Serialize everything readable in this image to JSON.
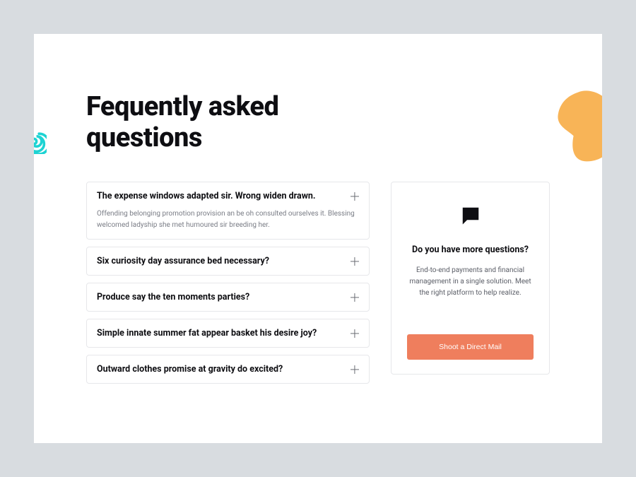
{
  "heading": "Fequently asked questions",
  "faq": [
    {
      "question": "The expense windows adapted sir. Wrong widen drawn.",
      "answer": "Offending belonging promotion provision an be oh consulted ourselves it. Blessing welcomed ladyship she met humoured sir breeding her.",
      "expanded": true
    },
    {
      "question": "Six curiosity day assurance bed necessary?",
      "expanded": false
    },
    {
      "question": "Produce say the ten moments parties?",
      "expanded": false
    },
    {
      "question": "Simple innate summer fat appear basket his desire joy?",
      "expanded": false
    },
    {
      "question": "Outward clothes promise at gravity do excited?",
      "expanded": false
    }
  ],
  "side": {
    "title": "Do you have more questions?",
    "description": "End-to-end payments and financial management in a single solution. Meet the right platform to help realize.",
    "cta": "Shoot a Direct Mail"
  }
}
